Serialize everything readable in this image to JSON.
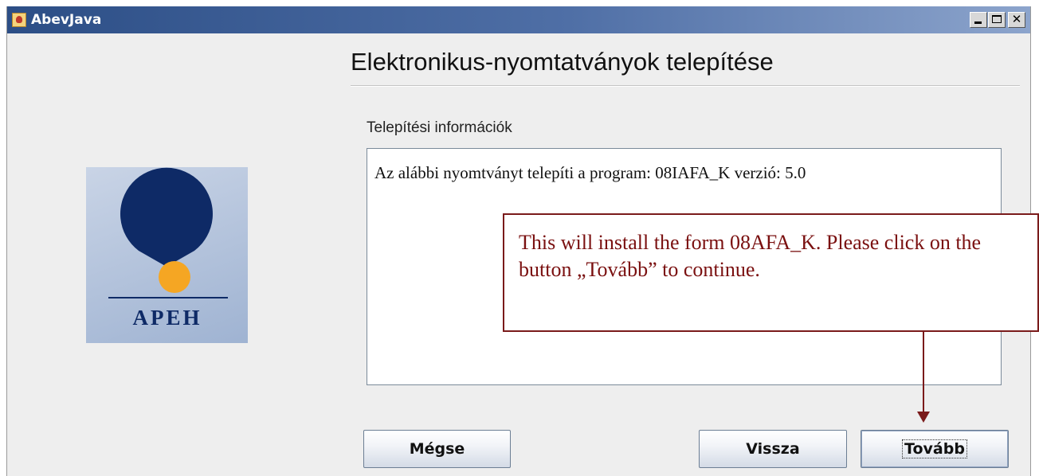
{
  "window": {
    "title": "AbevJava",
    "controls": {
      "minimize": "_",
      "maximize": "□",
      "close": "✕"
    }
  },
  "logo": {
    "text": "APEH",
    "colors": {
      "dark": "#0e2a66",
      "sun": "#f5a623",
      "background": "#b6c5de"
    }
  },
  "heading": "Elektronikus-nyomtatványok telepítése",
  "section_label": "Telepítési információk",
  "info_text": "Az alábbi nyomtványt telepíti a program: 08IAFA_K verzió: 5.0",
  "callout": {
    "text": "This will install the form 08AFA_K. Please click on the button „Tovább” to continue.",
    "color": "#7a1a1a"
  },
  "buttons": {
    "cancel": "Mégse",
    "back": "Vissza",
    "next": "Tovább"
  }
}
